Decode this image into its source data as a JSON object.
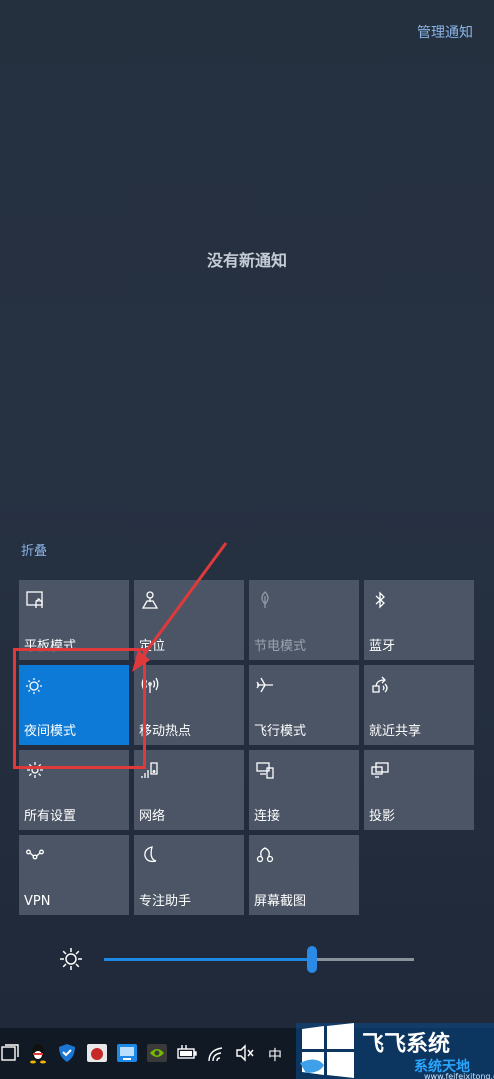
{
  "header": {
    "manage_label": "管理通知"
  },
  "notifications": {
    "empty_text": "没有新通知"
  },
  "quick_actions": {
    "collapse_label": "折叠",
    "tiles": [
      {
        "label": "平板模式",
        "icon": "tablet-mode-icon",
        "state": "off"
      },
      {
        "label": "定位",
        "icon": "location-icon",
        "state": "off"
      },
      {
        "label": "节电模式",
        "icon": "battery-saver-icon",
        "state": "disabled"
      },
      {
        "label": "蓝牙",
        "icon": "bluetooth-icon",
        "state": "off"
      },
      {
        "label": "夜间模式",
        "icon": "night-light-icon",
        "state": "on"
      },
      {
        "label": "移动热点",
        "icon": "mobile-hotspot-icon",
        "state": "off"
      },
      {
        "label": "飞行模式",
        "icon": "airplane-mode-icon",
        "state": "off"
      },
      {
        "label": "就近共享",
        "icon": "nearby-sharing-icon",
        "state": "off"
      },
      {
        "label": "所有设置",
        "icon": "settings-gear-icon",
        "state": "off"
      },
      {
        "label": "网络",
        "icon": "network-icon",
        "state": "off"
      },
      {
        "label": "连接",
        "icon": "connect-icon",
        "state": "off"
      },
      {
        "label": "投影",
        "icon": "project-icon",
        "state": "off"
      },
      {
        "label": "VPN",
        "icon": "vpn-icon",
        "state": "off"
      },
      {
        "label": "专注助手",
        "icon": "focus-assist-icon",
        "state": "off"
      },
      {
        "label": "屏幕截图",
        "icon": "screen-snip-icon",
        "state": "off"
      }
    ]
  },
  "brightness": {
    "icon": "brightness-sun-icon",
    "level": 0.67
  },
  "taskbar": {
    "ime_label": "中",
    "icons": [
      "task-view-icon",
      "qq-icon",
      "security-shield-icon",
      "red-app-icon",
      "network-monitor-icon",
      "nvidia-icon",
      "battery-icon",
      "wifi-icon",
      "volume-muted-icon"
    ]
  },
  "colors": {
    "accent": "#0c7ad6",
    "tile": "#4b5565",
    "link": "#8ab4e6",
    "annotation": "#e0393b"
  }
}
